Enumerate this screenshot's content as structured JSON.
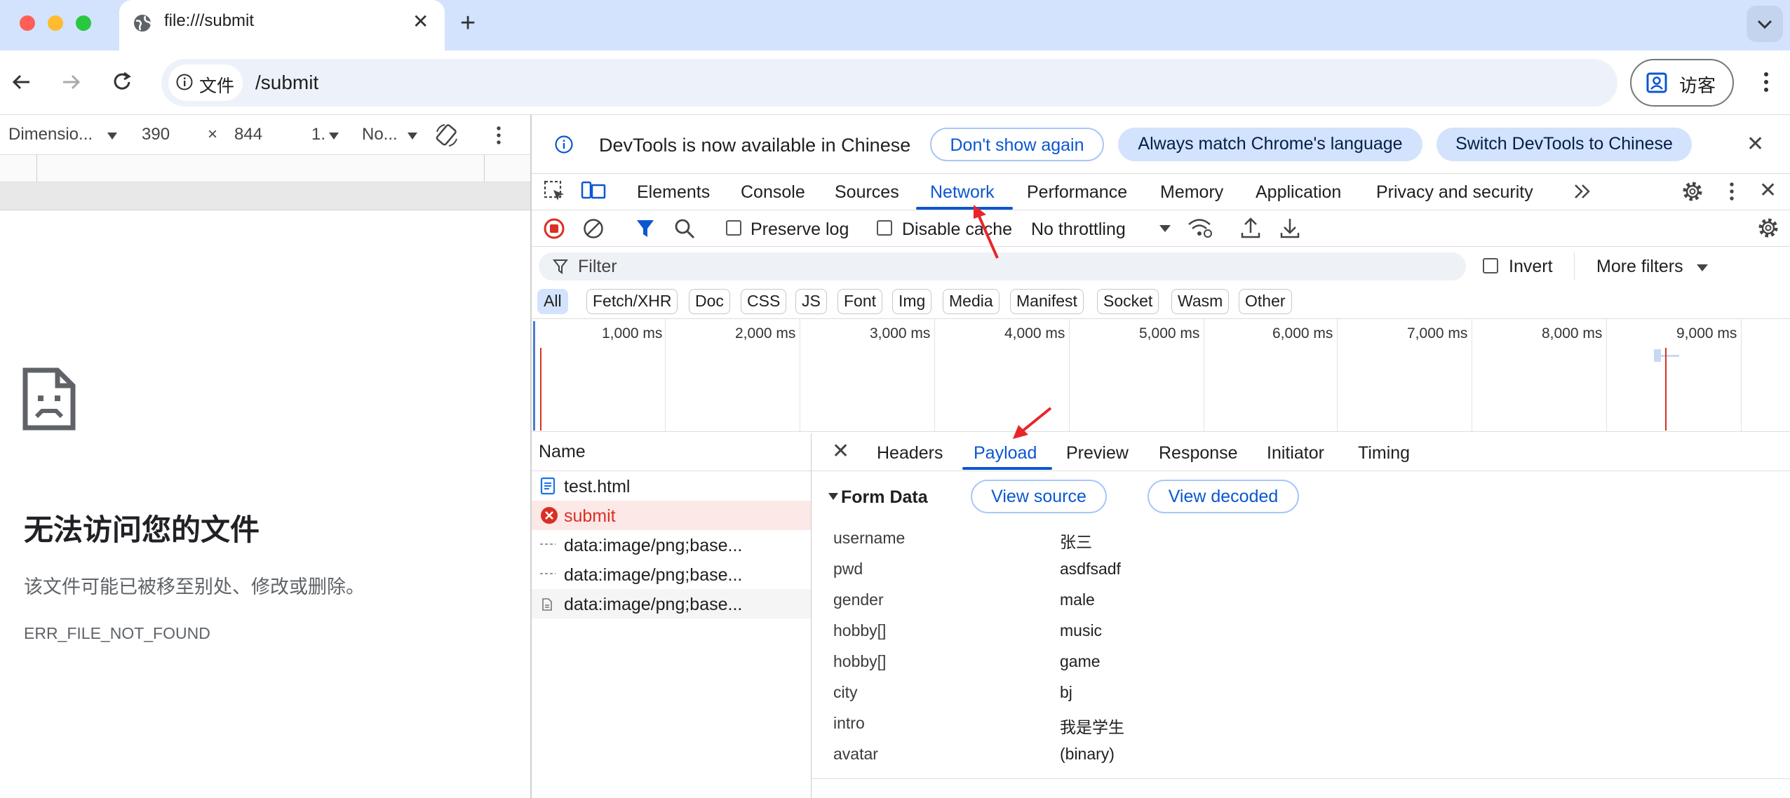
{
  "browser": {
    "tab_title": "file:///submit",
    "site_chip_label": "文件",
    "url": "/submit",
    "profile_label": "访客"
  },
  "device_toolbar": {
    "dimensions_label": "Dimensio...",
    "width": "390",
    "times": "×",
    "height": "844",
    "zoom": "1.",
    "throttle": "No..."
  },
  "error_page": {
    "title": "无法访问您的文件",
    "description": "该文件可能已被移至别处、修改或删除。",
    "code": "ERR_FILE_NOT_FOUND"
  },
  "infobar": {
    "message": "DevTools is now available in Chinese",
    "dont_show": "Don't show again",
    "always_match": "Always match Chrome's language",
    "switch": "Switch DevTools to Chinese"
  },
  "panel_tabs": [
    "Elements",
    "Console",
    "Sources",
    "Network",
    "Performance",
    "Memory",
    "Application",
    "Privacy and security"
  ],
  "network_toolbar": {
    "preserve_log": "Preserve log",
    "disable_cache": "Disable cache",
    "throttling": "No throttling"
  },
  "filter": {
    "placeholder": "Filter",
    "invert": "Invert",
    "more_filters": "More filters"
  },
  "type_chips": [
    "All",
    "Fetch/XHR",
    "Doc",
    "CSS",
    "JS",
    "Font",
    "Img",
    "Media",
    "Manifest",
    "Socket",
    "Wasm",
    "Other"
  ],
  "timeline_ticks": [
    "1,000 ms",
    "2,000 ms",
    "3,000 ms",
    "4,000 ms",
    "5,000 ms",
    "6,000 ms",
    "7,000 ms",
    "8,000 ms",
    "9,000 ms"
  ],
  "requests": {
    "header": "Name",
    "items": [
      "test.html",
      "submit",
      "data:image/png;base...",
      "data:image/png;base...",
      "data:image/png;base..."
    ]
  },
  "detail_tabs": [
    "Headers",
    "Payload",
    "Preview",
    "Response",
    "Initiator",
    "Timing"
  ],
  "form_data": {
    "title": "Form Data",
    "view_source": "View source",
    "view_decoded": "View decoded",
    "rows": [
      {
        "key": "username",
        "value": "张三"
      },
      {
        "key": "pwd",
        "value": "asdfsadf"
      },
      {
        "key": "gender",
        "value": "male"
      },
      {
        "key": "hobby[]",
        "value": "music"
      },
      {
        "key": "hobby[]",
        "value": "game"
      },
      {
        "key": "city",
        "value": "bj"
      },
      {
        "key": "intro",
        "value": "我是学生"
      },
      {
        "key": "avatar",
        "value": "(binary)"
      }
    ]
  },
  "colors": {
    "accent": "#0b57d0",
    "error": "#d93025",
    "annotation_arrow": "#e8262a"
  }
}
